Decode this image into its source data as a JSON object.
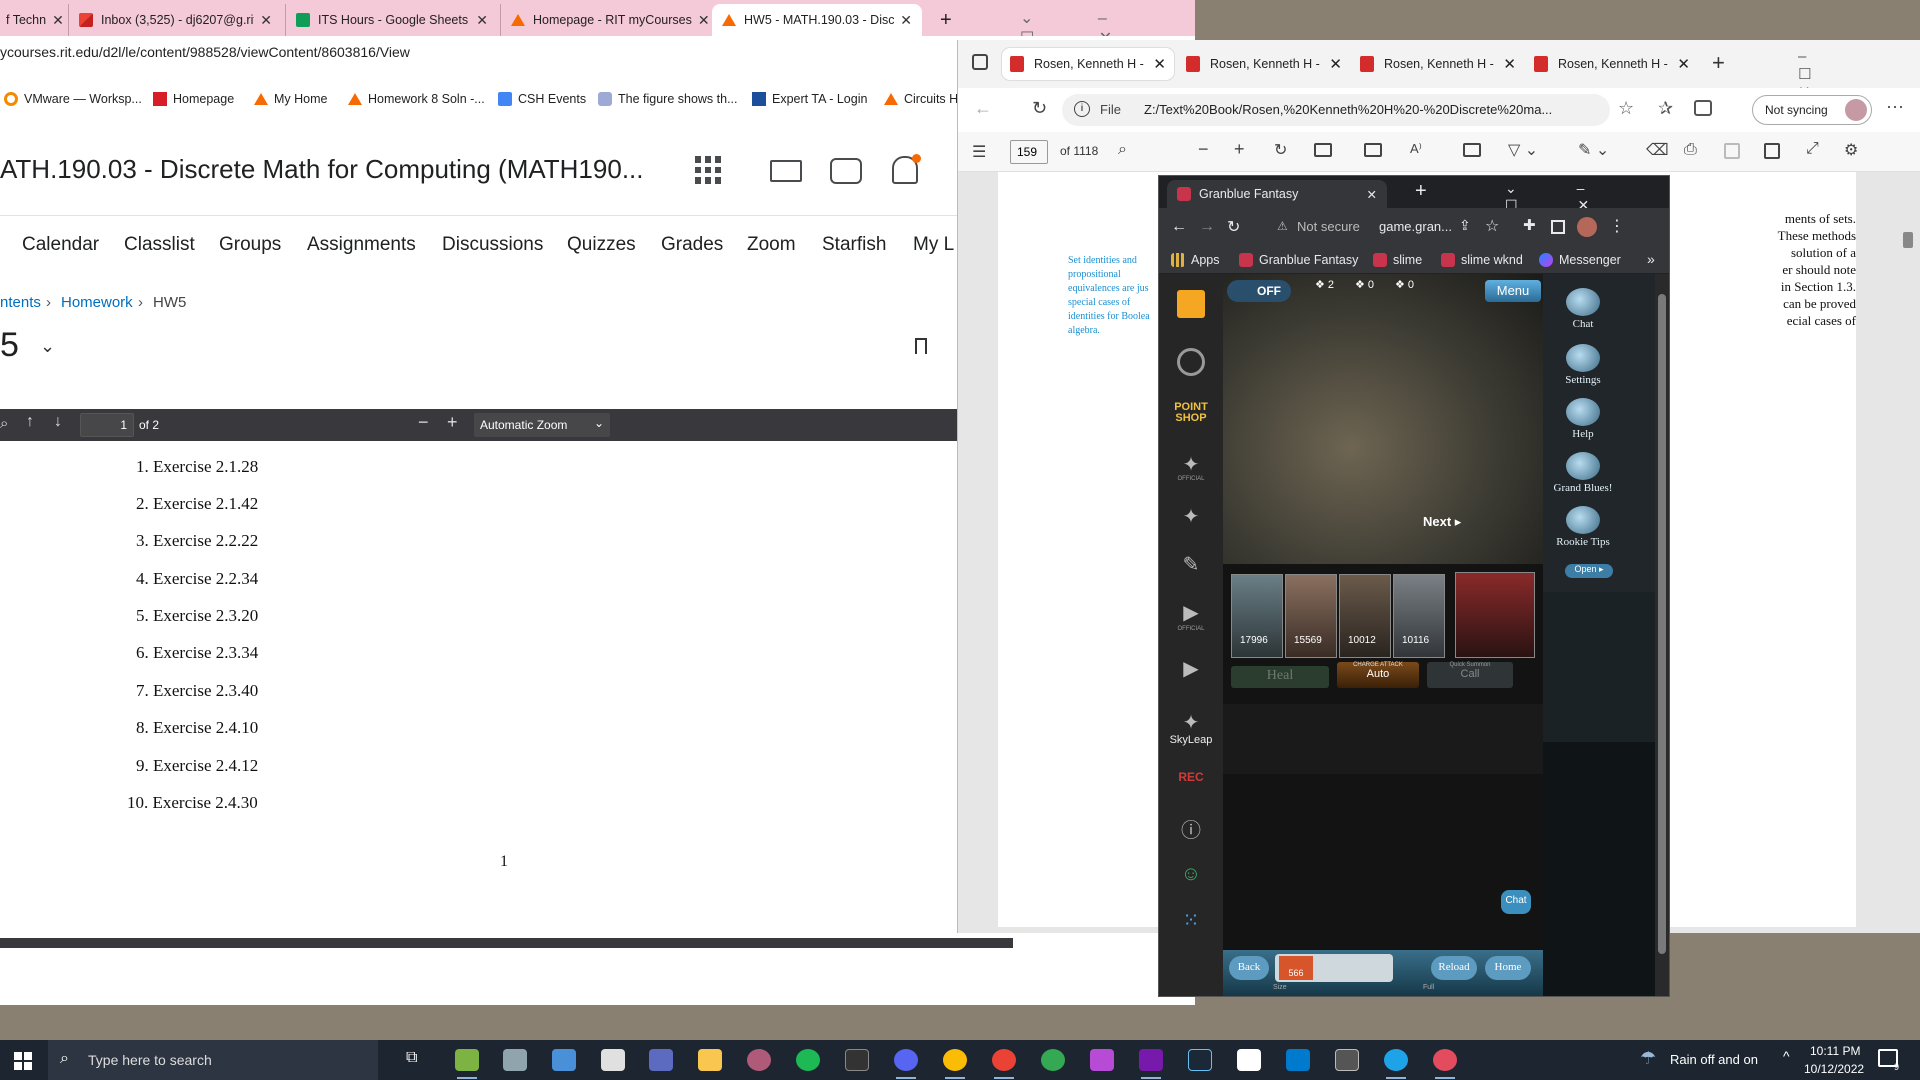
{
  "colors": {
    "desktop": "#8a8072",
    "left_tabbar": "#f4c9d8",
    "rit_orange": "#f76902",
    "d2l_blue": "#006fbf",
    "taskbar": "#1d2630",
    "granblue_dark": "#131313"
  },
  "left_browser": {
    "tabs": [
      {
        "label": "f Techn",
        "icon": "rit-icon"
      },
      {
        "label": "Inbox (3,525) - dj6207@g.rit",
        "icon": "gmail-icon"
      },
      {
        "label": "ITS Hours - Google Sheets",
        "icon": "sheets-icon"
      },
      {
        "label": "Homepage - RIT myCourses",
        "icon": "d2l-icon"
      },
      {
        "label": "HW5 - MATH.190.03 - Discre",
        "icon": "d2l-icon"
      }
    ],
    "new_tab": "+",
    "url": "ycourses.rit.edu/d2l/le/content/988528/viewContent/8603816/View",
    "bookmarks": [
      {
        "label": "VMware — Worksp...",
        "icon": "vmware-icon"
      },
      {
        "label": "Homepage",
        "icon": "homepage-icon"
      },
      {
        "label": "My Home",
        "icon": "d2l-icon"
      },
      {
        "label": "Homework 8 Soln -...",
        "icon": "d2l-icon"
      },
      {
        "label": "CSH Events",
        "icon": "calendar-icon"
      },
      {
        "label": "The figure shows th...",
        "icon": "quill-icon"
      },
      {
        "label": "Expert TA - Login",
        "icon": "expertta-icon"
      },
      {
        "label": "Circuits H",
        "icon": "d2l-icon"
      }
    ],
    "course_title": "ATH.190.03 - Discrete Math for Computing (MATH190...",
    "nav": [
      "Calendar",
      "Classlist",
      "Groups",
      "Assignments",
      "Discussions",
      "Quizzes",
      "Grades",
      "Zoom",
      "Starfish",
      "My L"
    ],
    "breadcrumb": {
      "first": "ntents",
      "second": "Homework",
      "current": "HW5",
      "sep": "›"
    },
    "page_heading": "5",
    "pdf_viewer": {
      "page_value": "1",
      "page_total": "of 2",
      "zoom": "Automatic Zoom",
      "minus": "−",
      "plus": "+"
    },
    "exercises": [
      {
        "num": "1.",
        "text": "Exercise 2.1.28"
      },
      {
        "num": "2.",
        "text": "Exercise 2.1.42"
      },
      {
        "num": "3.",
        "text": "Exercise 2.2.22"
      },
      {
        "num": "4.",
        "text": "Exercise 2.2.34"
      },
      {
        "num": "5.",
        "text": "Exercise 2.3.20"
      },
      {
        "num": "6.",
        "text": "Exercise 2.3.34"
      },
      {
        "num": "7.",
        "text": "Exercise 2.3.40"
      },
      {
        "num": "8.",
        "text": "Exercise 2.4.10"
      },
      {
        "num": "9.",
        "text": "Exercise 2.4.12"
      },
      {
        "num": "10.",
        "text": "Exercise 2.4.30"
      }
    ],
    "page_number": "1"
  },
  "edge_browser": {
    "tabs": [
      "Rosen, Kenneth H -",
      "Rosen, Kenneth H -",
      "Rosen, Kenneth H -",
      "Rosen, Kenneth H -"
    ],
    "file_label": "File",
    "url": "Z:/Text%20Book/Rosen,%20Kenneth%20H%20-%20Discrete%20ma...",
    "sync": "Not syncing",
    "page_value": "159",
    "page_total": "of 1118",
    "margin_note": [
      "Set identities and",
      "propositional",
      "equivalences are jus",
      "special cases of",
      "identities for Boolea",
      "algebra."
    ],
    "body_lines": [
      "ments of sets.",
      "These methods",
      "solution of a",
      "er should note",
      "in Section 1.3.",
      "can be proved",
      "ecial cases of"
    ]
  },
  "granblue_browser": {
    "tab_title": "Granblue Fantasy",
    "addr_warning": "Not secure",
    "url": "game.gran...",
    "bookmarks": [
      "Apps",
      "Granblue Fantasy",
      "slime",
      "slime wknd",
      "Messenger"
    ],
    "side_labels": {
      "point_shop": "POINT SHOP",
      "official": "OFFICIAL",
      "skyleap": "SkyLeap",
      "rec": "REC"
    },
    "top": {
      "auto": "OFF",
      "count1": "2",
      "count2": "0",
      "count3": "0",
      "menu": "Menu"
    },
    "right_buttons": [
      "Chat",
      "Settings",
      "Help",
      "Grand Blues!",
      "Rookie Tips"
    ],
    "open": "Open ▸",
    "next": "Next ▸",
    "party_hp": [
      "17996",
      "15569",
      "10012",
      "10116"
    ],
    "actions": {
      "heal": "Heal",
      "charge_title": "CHARGE ATTACK",
      "auto": "Auto",
      "summon_title": "Quick Summon",
      "call": "Call"
    },
    "chat_bubble": "Chat",
    "bottom": {
      "back": "Back",
      "reload": "Reload",
      "home": "Home",
      "size": "Size",
      "full": "Full",
      "gauge": "566"
    }
  },
  "taskbar": {
    "search_placeholder": "Type here to search",
    "weather": "Rain off and on",
    "time": "10:11 PM",
    "date": "10/12/2022",
    "notif_count": "9"
  }
}
